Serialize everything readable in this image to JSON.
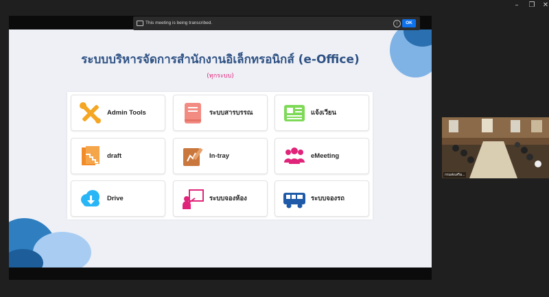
{
  "window": {
    "minimize": "–",
    "restore": "❐",
    "close": "✕"
  },
  "notice": {
    "text": "This meeting is being transcribed.",
    "ok_label": "OK",
    "info_icon": "ⓘ"
  },
  "slide": {
    "title": "ระบบบริหารจัดการสำนักงานอิเล็กทรอนิกส์ (e-Office)",
    "subtitle": "(ทุกระบบ)",
    "apps": [
      {
        "label": "Admin Tools",
        "icon": "tools-icon",
        "color": "#f5a623"
      },
      {
        "label": "ระบบสารบรรณ",
        "icon": "book-icon",
        "color": "#f28b82"
      },
      {
        "label": "แจ้งเวียน",
        "icon": "newspaper-icon",
        "color": "#7ed957"
      },
      {
        "label": "draft",
        "icon": "draft-icon",
        "color": "#f28c28"
      },
      {
        "label": "In-tray",
        "icon": "intray-icon",
        "color": "#c9773d"
      },
      {
        "label": "eMeeting",
        "icon": "meeting-icon",
        "color": "#e0247a"
      },
      {
        "label": "Drive",
        "icon": "cloud-download-icon",
        "color": "#29b6f6"
      },
      {
        "label": "ระบบจองห้อง",
        "icon": "presenter-icon",
        "color": "#e0247a"
      },
      {
        "label": "ระบบจองรถ",
        "icon": "bus-icon",
        "color": "#1e5aa8"
      }
    ]
  },
  "participant": {
    "name": "กรมส่งเสริม..."
  }
}
